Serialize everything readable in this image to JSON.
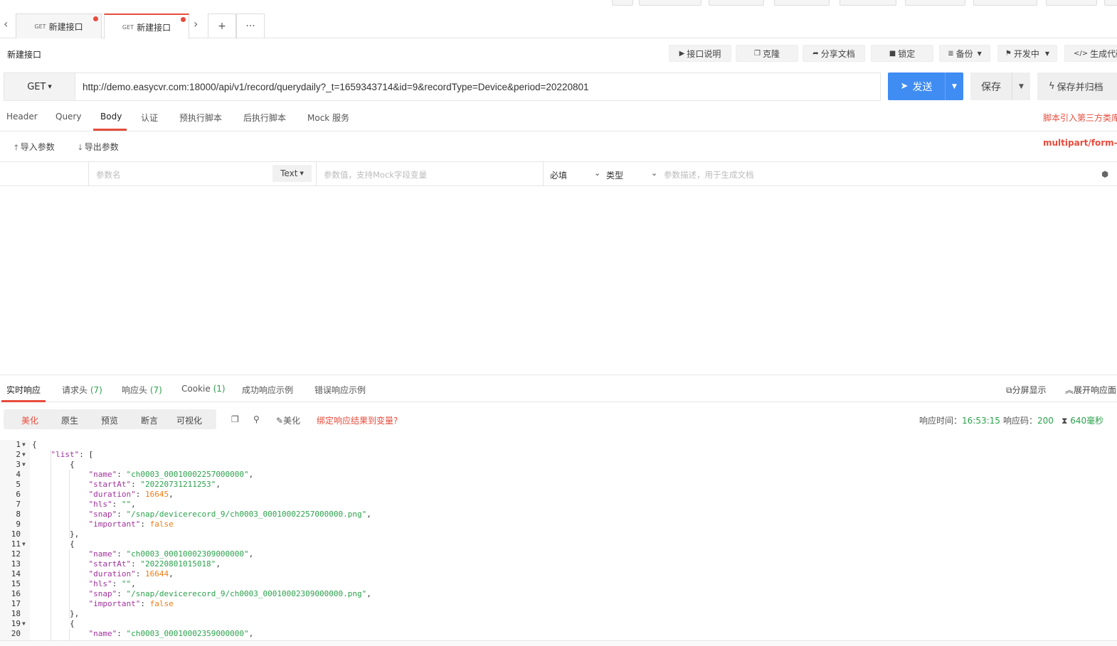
{
  "top_buttons": [
    {
      "label": ""
    },
    {
      "label": ""
    },
    {
      "label": ""
    },
    {
      "label": ""
    },
    {
      "label": ""
    },
    {
      "label": ""
    },
    {
      "label": ""
    },
    {
      "label": ""
    },
    {
      "label": ""
    }
  ],
  "tabs": [
    {
      "method": "GET",
      "label": "新建接口"
    },
    {
      "method": "GET",
      "label": "新建接口"
    }
  ],
  "tab_actions": {
    "add": "+",
    "more": "···"
  },
  "api_name": "新建接口",
  "toolbar": {
    "doc": "接口说明",
    "clone": "克隆",
    "share": "分享文档",
    "lock": "锁定",
    "backup": "备份",
    "status": "开发中",
    "codegen": "生成代码"
  },
  "request": {
    "method": "GET",
    "url": "http://demo.easycvr.com:18000/api/v1/record/querydaily?_t=1659343714&id=9&recordType=Device&period=20220801",
    "send": "发送",
    "save": "保存",
    "save_archive": "保存并归档"
  },
  "req_tabs": [
    "Header",
    "Query",
    "Body",
    "认证",
    "预执行脚本",
    "后执行脚本",
    "Mock 服务"
  ],
  "script_link": "脚本引入第三方类库",
  "content_type": "multipart/form-data",
  "import_label": "导入参数",
  "export_label": "导出参数",
  "param": {
    "name_placeholder": "参数名",
    "type": "Text",
    "value_placeholder": "参数值，支持Mock字段变量",
    "required": "必填",
    "kind": "类型",
    "desc_placeholder": "参数描述，用于生成文档"
  },
  "resp_tabs": [
    {
      "label": "实时响应",
      "count": ""
    },
    {
      "label": "请求头",
      "count": "(7)"
    },
    {
      "label": "响应头",
      "count": "(7)"
    },
    {
      "label": "Cookie",
      "count": "(1)"
    },
    {
      "label": "成功响应示例",
      "count": ""
    },
    {
      "label": "错误响应示例",
      "count": ""
    }
  ],
  "split_view": "分屏显示",
  "expand_resp": "展开响应面",
  "format_tabs": [
    "美化",
    "原生",
    "预览",
    "断言",
    "可视化"
  ],
  "beautify": "美化",
  "bind_link": "绑定响应结果到变量?",
  "stats": {
    "time_label": "响应时间：",
    "time_value": "16:53:15",
    "code_label": "响应码：",
    "code_value": "200",
    "duration": "640毫秒"
  },
  "code_lines": [
    {
      "n": "1",
      "fold": true,
      "html": "{"
    },
    {
      "n": "2",
      "fold": true,
      "html": "    <span class='k'>\"list\"</span>: ["
    },
    {
      "n": "3",
      "fold": true,
      "html": "        {"
    },
    {
      "n": "4",
      "fold": false,
      "html": "            <span class='k'>\"name\"</span>: <span class='s'>\"ch0003_00010002257000000\"</span>,"
    },
    {
      "n": "5",
      "fold": false,
      "html": "            <span class='k'>\"startAt\"</span>: <span class='s'>\"20220731211253\"</span>,"
    },
    {
      "n": "6",
      "fold": false,
      "html": "            <span class='k'>\"duration\"</span>: <span class='n'>16645</span>,"
    },
    {
      "n": "7",
      "fold": false,
      "html": "            <span class='k'>\"hls\"</span>: <span class='s'>\"\"</span>,"
    },
    {
      "n": "8",
      "fold": false,
      "html": "            <span class='k'>\"snap\"</span>: <span class='s'>\"/snap/devicerecord_9/ch0003_00010002257000000.png\"</span>,"
    },
    {
      "n": "9",
      "fold": false,
      "html": "            <span class='k'>\"important\"</span>: <span class='b'>false</span>"
    },
    {
      "n": "10",
      "fold": false,
      "html": "        },"
    },
    {
      "n": "11",
      "fold": true,
      "html": "        {"
    },
    {
      "n": "12",
      "fold": false,
      "html": "            <span class='k'>\"name\"</span>: <span class='s'>\"ch0003_00010002309000000\"</span>,"
    },
    {
      "n": "13",
      "fold": false,
      "html": "            <span class='k'>\"startAt\"</span>: <span class='s'>\"20220801015018\"</span>,"
    },
    {
      "n": "14",
      "fold": false,
      "html": "            <span class='k'>\"duration\"</span>: <span class='n'>16644</span>,"
    },
    {
      "n": "15",
      "fold": false,
      "html": "            <span class='k'>\"hls\"</span>: <span class='s'>\"\"</span>,"
    },
    {
      "n": "16",
      "fold": false,
      "html": "            <span class='k'>\"snap\"</span>: <span class='s'>\"/snap/devicerecord_9/ch0003_00010002309000000.png\"</span>,"
    },
    {
      "n": "17",
      "fold": false,
      "html": "            <span class='k'>\"important\"</span>: <span class='b'>false</span>"
    },
    {
      "n": "18",
      "fold": false,
      "html": "        },"
    },
    {
      "n": "19",
      "fold": true,
      "html": "        {"
    },
    {
      "n": "20",
      "fold": false,
      "html": "            <span class='k'>\"name\"</span>: <span class='s'>\"ch0003_00010002359000000\"</span>,"
    }
  ]
}
